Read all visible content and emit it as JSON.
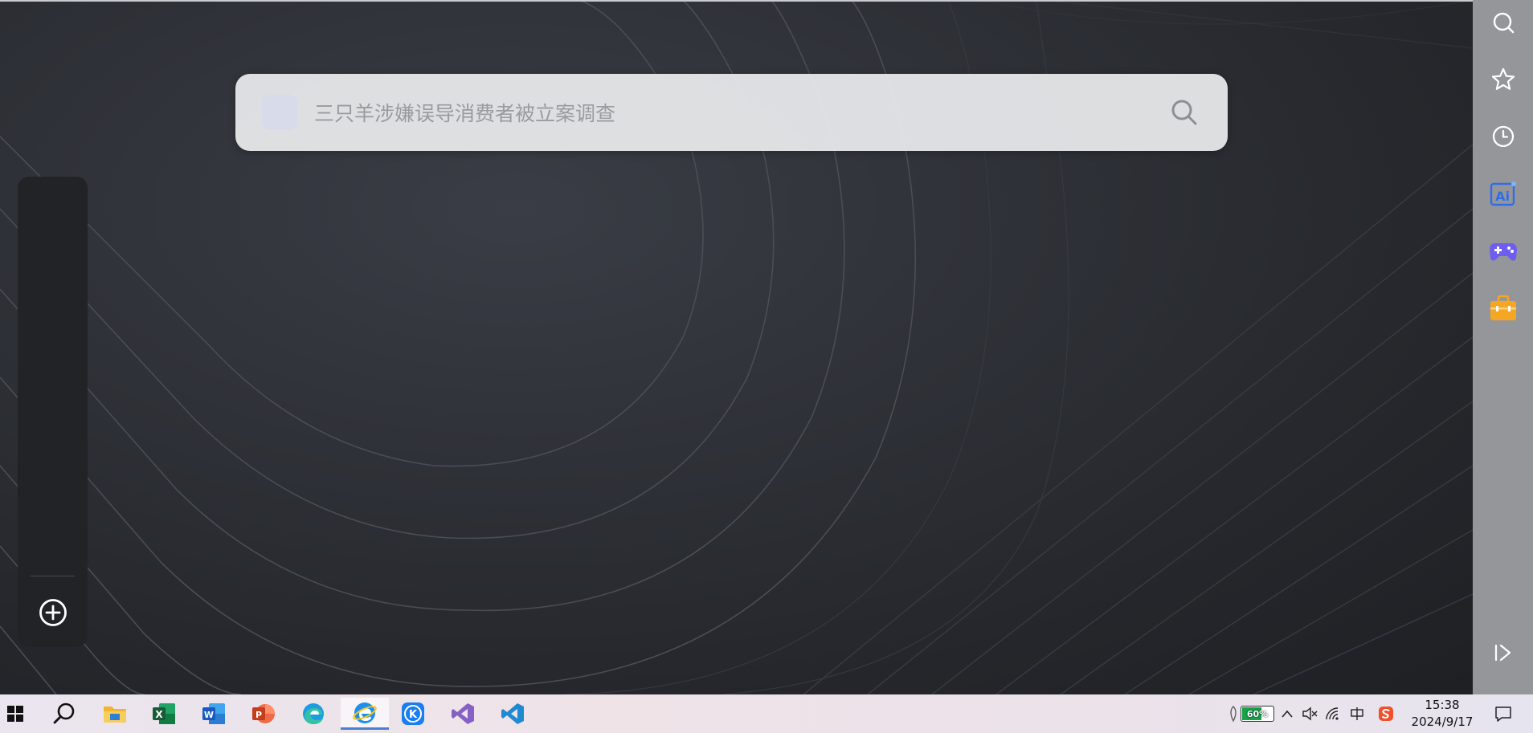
{
  "search": {
    "placeholder": "三只羊涉嫌误导消费者被立案调查",
    "value": ""
  },
  "left_dock": {
    "add_label": "+"
  },
  "right_sidebar": {
    "items": [
      {
        "icon": "search-icon"
      },
      {
        "icon": "star-icon"
      },
      {
        "icon": "clock-icon"
      },
      {
        "icon": "ai-icon",
        "text": "Ai"
      },
      {
        "icon": "gamepad-icon"
      },
      {
        "icon": "toolbox-icon"
      }
    ],
    "collapse_icon": "collapse-sidebar-icon"
  },
  "taskbar": {
    "apps": [
      {
        "icon": "windows-start-icon"
      },
      {
        "icon": "search-icon"
      },
      {
        "icon": "file-explorer-icon"
      },
      {
        "icon": "excel-icon",
        "letter": "X"
      },
      {
        "icon": "word-icon",
        "letter": "W"
      },
      {
        "icon": "powerpoint-icon",
        "letter": "P"
      },
      {
        "icon": "edge-icon"
      },
      {
        "icon": "browser-icon",
        "active": true
      },
      {
        "icon": "k-app-icon",
        "letter": "K"
      },
      {
        "icon": "visual-studio-icon"
      },
      {
        "icon": "vscode-icon"
      }
    ],
    "tray": {
      "battery": "60%",
      "time": "15:38",
      "date": "2024/9/17"
    }
  },
  "colors": {
    "accent_blue": "#2f6fe0",
    "ai_blue": "#2d6fe8",
    "game_purple": "#6d5df0",
    "toolbox_orange": "#f5a623"
  }
}
